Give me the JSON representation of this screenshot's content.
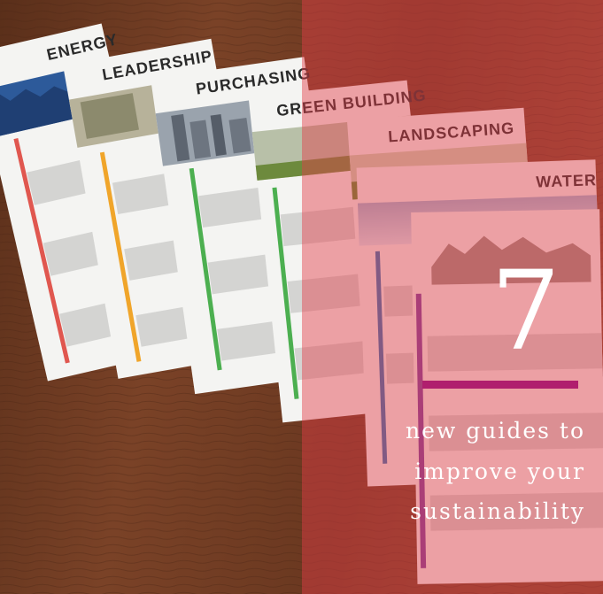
{
  "poster_headers": [
    "ENERGY",
    "LEADERSHIP",
    "PURCHASING",
    "GREEN BUILDING",
    "LANDSCAPING",
    "WATER"
  ],
  "overlay": {
    "number": "7",
    "tagline_lines": [
      "new guides to",
      "improve your",
      "sustainability"
    ]
  },
  "colors": {
    "table": "#6b3a22",
    "overlay": "#e23c48",
    "accent_bar": "#b01f6e",
    "text": "#ffffff"
  }
}
